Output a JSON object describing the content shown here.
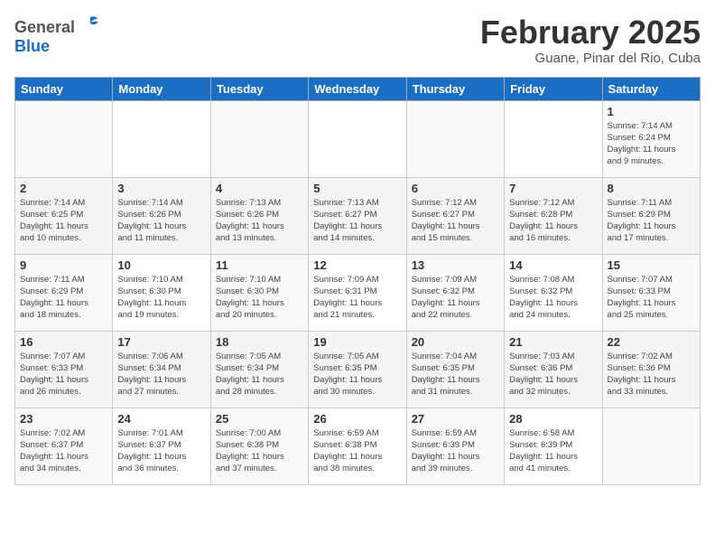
{
  "header": {
    "logo_general": "General",
    "logo_blue": "Blue",
    "title": "February 2025",
    "subtitle": "Guane, Pinar del Rio, Cuba"
  },
  "days_of_week": [
    "Sunday",
    "Monday",
    "Tuesday",
    "Wednesday",
    "Thursday",
    "Friday",
    "Saturday"
  ],
  "weeks": [
    [
      {
        "day": "",
        "info": ""
      },
      {
        "day": "",
        "info": ""
      },
      {
        "day": "",
        "info": ""
      },
      {
        "day": "",
        "info": ""
      },
      {
        "day": "",
        "info": ""
      },
      {
        "day": "",
        "info": ""
      },
      {
        "day": "1",
        "info": "Sunrise: 7:14 AM\nSunset: 6:24 PM\nDaylight: 11 hours\nand 9 minutes."
      }
    ],
    [
      {
        "day": "2",
        "info": "Sunrise: 7:14 AM\nSunset: 6:25 PM\nDaylight: 11 hours\nand 10 minutes."
      },
      {
        "day": "3",
        "info": "Sunrise: 7:14 AM\nSunset: 6:26 PM\nDaylight: 11 hours\nand 11 minutes."
      },
      {
        "day": "4",
        "info": "Sunrise: 7:13 AM\nSunset: 6:26 PM\nDaylight: 11 hours\nand 13 minutes."
      },
      {
        "day": "5",
        "info": "Sunrise: 7:13 AM\nSunset: 6:27 PM\nDaylight: 11 hours\nand 14 minutes."
      },
      {
        "day": "6",
        "info": "Sunrise: 7:12 AM\nSunset: 6:27 PM\nDaylight: 11 hours\nand 15 minutes."
      },
      {
        "day": "7",
        "info": "Sunrise: 7:12 AM\nSunset: 6:28 PM\nDaylight: 11 hours\nand 16 minutes."
      },
      {
        "day": "8",
        "info": "Sunrise: 7:11 AM\nSunset: 6:29 PM\nDaylight: 11 hours\nand 17 minutes."
      }
    ],
    [
      {
        "day": "9",
        "info": "Sunrise: 7:11 AM\nSunset: 6:29 PM\nDaylight: 11 hours\nand 18 minutes."
      },
      {
        "day": "10",
        "info": "Sunrise: 7:10 AM\nSunset: 6:30 PM\nDaylight: 11 hours\nand 19 minutes."
      },
      {
        "day": "11",
        "info": "Sunrise: 7:10 AM\nSunset: 6:30 PM\nDaylight: 11 hours\nand 20 minutes."
      },
      {
        "day": "12",
        "info": "Sunrise: 7:09 AM\nSunset: 6:31 PM\nDaylight: 11 hours\nand 21 minutes."
      },
      {
        "day": "13",
        "info": "Sunrise: 7:09 AM\nSunset: 6:32 PM\nDaylight: 11 hours\nand 22 minutes."
      },
      {
        "day": "14",
        "info": "Sunrise: 7:08 AM\nSunset: 6:32 PM\nDaylight: 11 hours\nand 24 minutes."
      },
      {
        "day": "15",
        "info": "Sunrise: 7:07 AM\nSunset: 6:33 PM\nDaylight: 11 hours\nand 25 minutes."
      }
    ],
    [
      {
        "day": "16",
        "info": "Sunrise: 7:07 AM\nSunset: 6:33 PM\nDaylight: 11 hours\nand 26 minutes."
      },
      {
        "day": "17",
        "info": "Sunrise: 7:06 AM\nSunset: 6:34 PM\nDaylight: 11 hours\nand 27 minutes."
      },
      {
        "day": "18",
        "info": "Sunrise: 7:05 AM\nSunset: 6:34 PM\nDaylight: 11 hours\nand 28 minutes."
      },
      {
        "day": "19",
        "info": "Sunrise: 7:05 AM\nSunset: 6:35 PM\nDaylight: 11 hours\nand 30 minutes."
      },
      {
        "day": "20",
        "info": "Sunrise: 7:04 AM\nSunset: 6:35 PM\nDaylight: 11 hours\nand 31 minutes."
      },
      {
        "day": "21",
        "info": "Sunrise: 7:03 AM\nSunset: 6:36 PM\nDaylight: 11 hours\nand 32 minutes."
      },
      {
        "day": "22",
        "info": "Sunrise: 7:02 AM\nSunset: 6:36 PM\nDaylight: 11 hours\nand 33 minutes."
      }
    ],
    [
      {
        "day": "23",
        "info": "Sunrise: 7:02 AM\nSunset: 6:37 PM\nDaylight: 11 hours\nand 34 minutes."
      },
      {
        "day": "24",
        "info": "Sunrise: 7:01 AM\nSunset: 6:37 PM\nDaylight: 11 hours\nand 36 minutes."
      },
      {
        "day": "25",
        "info": "Sunrise: 7:00 AM\nSunset: 6:38 PM\nDaylight: 11 hours\nand 37 minutes."
      },
      {
        "day": "26",
        "info": "Sunrise: 6:59 AM\nSunset: 6:38 PM\nDaylight: 11 hours\nand 38 minutes."
      },
      {
        "day": "27",
        "info": "Sunrise: 6:59 AM\nSunset: 6:39 PM\nDaylight: 11 hours\nand 39 minutes."
      },
      {
        "day": "28",
        "info": "Sunrise: 6:58 AM\nSunset: 6:39 PM\nDaylight: 11 hours\nand 41 minutes."
      },
      {
        "day": "",
        "info": ""
      }
    ]
  ]
}
